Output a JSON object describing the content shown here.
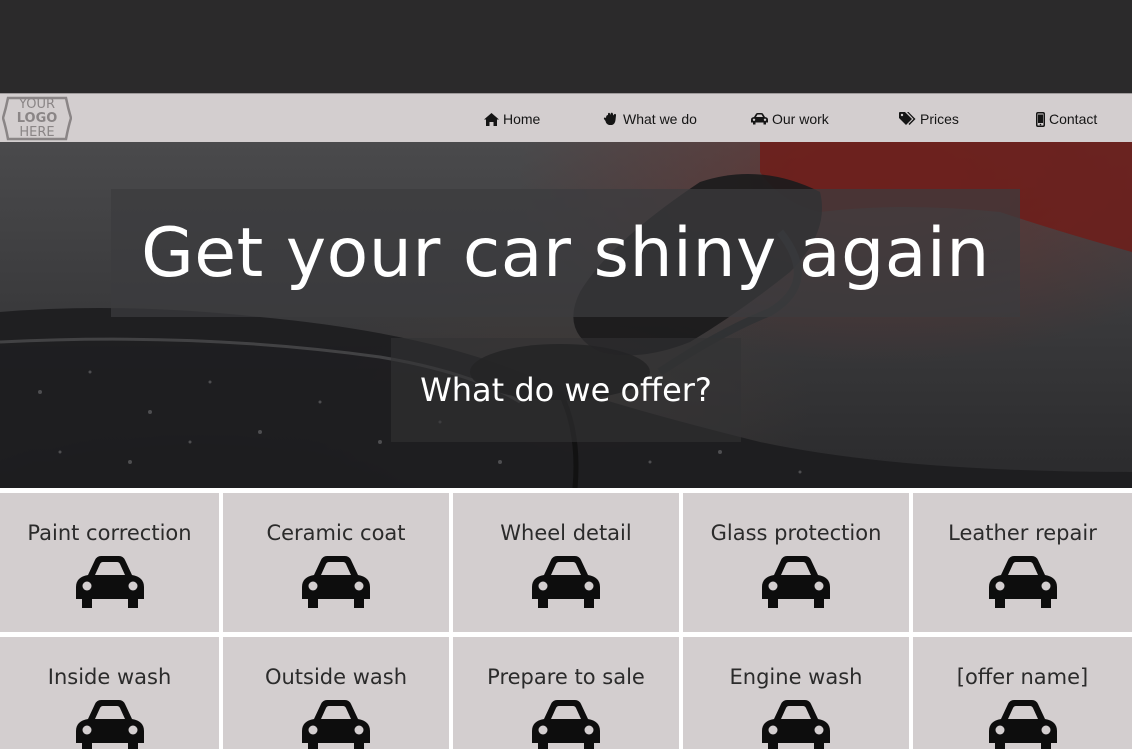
{
  "logo": {
    "line1": "YOUR",
    "line2": "LOGO",
    "line3": "HERE"
  },
  "nav": [
    {
      "label": "Home",
      "icon": "home-icon"
    },
    {
      "label": "What we do",
      "icon": "hand-icon"
    },
    {
      "label": "Our work",
      "icon": "car-icon"
    },
    {
      "label": "Prices",
      "icon": "tags-icon"
    },
    {
      "label": "Contact",
      "icon": "mobile-icon"
    }
  ],
  "hero": {
    "headline": "Get your car shiny again",
    "subheading": "What do we offer?"
  },
  "offers": [
    {
      "label": "Paint correction",
      "icon": "car-icon"
    },
    {
      "label": "Ceramic coat",
      "icon": "car-icon"
    },
    {
      "label": "Wheel detail",
      "icon": "car-icon"
    },
    {
      "label": "Glass protection",
      "icon": "car-icon"
    },
    {
      "label": "Leather repair",
      "icon": "car-icon"
    },
    {
      "label": "Inside wash",
      "icon": "car-icon"
    },
    {
      "label": "Outside wash",
      "icon": "car-icon"
    },
    {
      "label": "Prepare to sale",
      "icon": "car-icon"
    },
    {
      "label": "Engine wash",
      "icon": "car-icon"
    },
    {
      "label": "[offer name]",
      "icon": "car-icon"
    }
  ],
  "colors": {
    "topbar": "#2b2a2b",
    "navbar": "#d3cecf",
    "tile": "#d3cecf",
    "text_dark": "#151515",
    "hero_text": "#ffffff"
  }
}
